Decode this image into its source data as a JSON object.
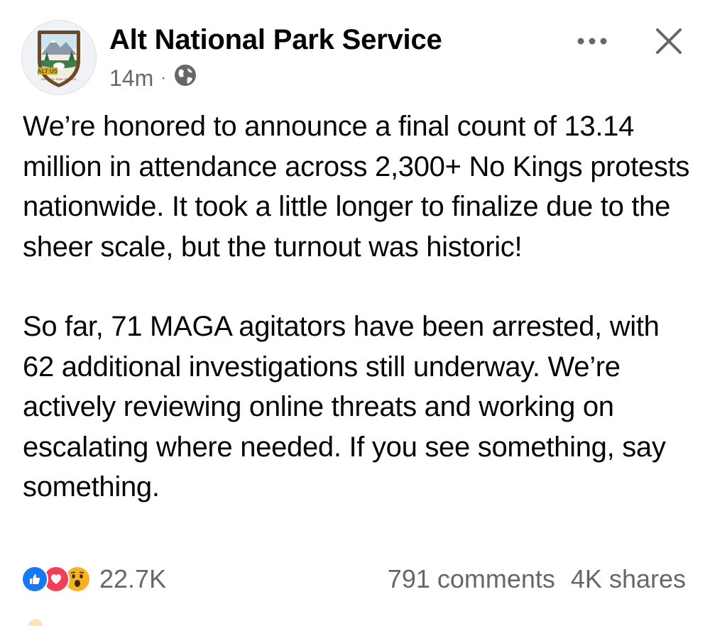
{
  "post": {
    "author": "Alt National Park Service",
    "timestamp": "14m",
    "separator": "·",
    "privacy_icon": "globe-icon",
    "more_icon": "more-horizontal-icon",
    "close_icon": "close-icon",
    "avatar": {
      "icon": "alt-us-nps-logo-icon",
      "badge_text": "ALT US",
      "badge_subtext": "NATIONAL PARK SERVICE"
    },
    "paragraphs": [
      "We’re honored to announce a final count of 13.14 million in attendance across 2,300+ No Kings protests nationwide. It took a little longer to finalize due to the sheer scale, but the turnout was historic!",
      "So far, 71 MAGA agitators have been arrested, with 62 additional investigations still underway. We’re actively reviewing online threats and working on escalating where needed. If you see something, say something."
    ]
  },
  "footer": {
    "reaction_icons": [
      "like-icon",
      "love-icon",
      "wow-icon"
    ],
    "reaction_count": "22.7K",
    "comments": "791 comments",
    "shares": "4K shares"
  },
  "colors": {
    "text": "#050505",
    "secondary": "#65676b",
    "like": "#1877f2",
    "love": "#f33e58",
    "wow": "#f7b125",
    "badge_brown": "#6b4a2a",
    "badge_green": "#2f6b3a"
  }
}
